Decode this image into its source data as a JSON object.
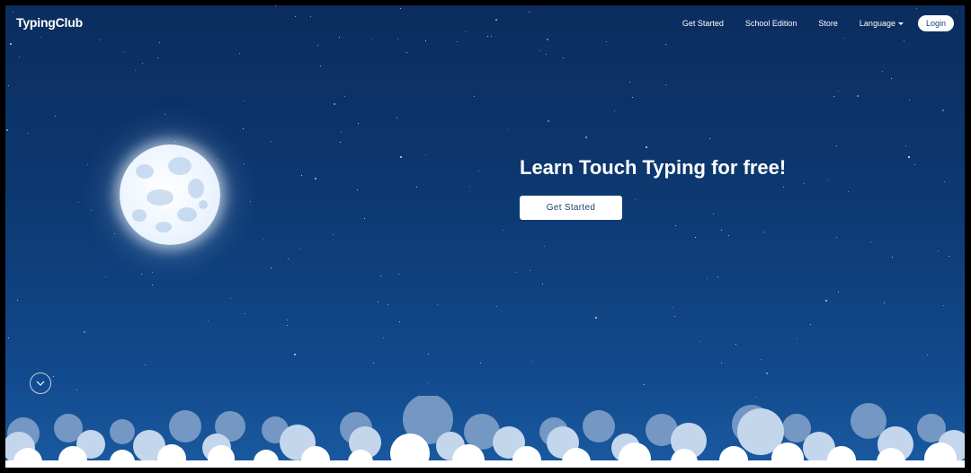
{
  "brand": {
    "logo_text": "TypingClub"
  },
  "nav": {
    "items": [
      {
        "label": "Get Started"
      },
      {
        "label": "School Edition"
      },
      {
        "label": "Store"
      },
      {
        "label": "Language"
      }
    ],
    "login_label": "Login"
  },
  "hero": {
    "title": "Learn Touch Typing for free!",
    "cta_label": "Get Started"
  },
  "scroll": {
    "icon": "chevron-down-icon"
  },
  "colors": {
    "sky_top": "#0b2d5e",
    "sky_bottom": "#1a5aa0",
    "button_text": "#1e3f6e",
    "cloud_back": "#8fb0d8",
    "cloud_mid": "#c4d6ec",
    "cloud_front": "#ffffff"
  }
}
